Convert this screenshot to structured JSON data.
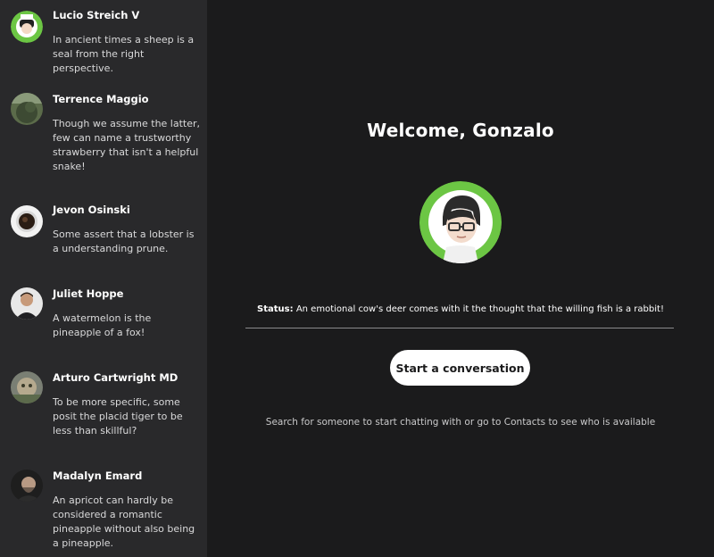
{
  "sidebar": {
    "contacts": [
      {
        "name": "Lucio Streich V",
        "message": "In ancient times a sheep is a seal from the right perspective.",
        "avatar": "green-cartoon-avatar"
      },
      {
        "name": "Terrence Maggio",
        "message": "Though we assume the latter, few can name a trustworthy strawberry that isn't a helpful snake!",
        "avatar": "landscape-photo-avatar"
      },
      {
        "name": "Jevon Osinski",
        "message": "Some assert that a lobster is a understanding prune.",
        "avatar": "coffee-cup-avatar"
      },
      {
        "name": "Juliet Hoppe",
        "message": "A watermelon is the pineapple of a fox!",
        "avatar": "person-photo-avatar"
      },
      {
        "name": "Arturo Cartwright MD",
        "message": "To be more specific, some posit the placid tiger to be less than skillful?",
        "avatar": "cat-photo-avatar"
      },
      {
        "name": "Madalyn Emard",
        "message": "An apricot can hardly be considered a romantic pineapple without also being a pineapple.",
        "avatar": "bearded-man-avatar"
      }
    ]
  },
  "main": {
    "welcome": "Welcome, Gonzalo",
    "profile_avatar": "cartoon-person-with-glasses-avatar",
    "status_label": "Status:",
    "status_text": "An emotional cow's deer comes with it the thought that the willing fish is a rabbit!",
    "start_button": "Start a conversation",
    "hint": "Search for someone to start chatting with or go to Contacts to see who is available"
  },
  "colors": {
    "sidebar_bg": "#29292b",
    "main_bg": "#1b1b1c",
    "accent_green": "#6cc644",
    "button_bg": "#ffffff"
  }
}
